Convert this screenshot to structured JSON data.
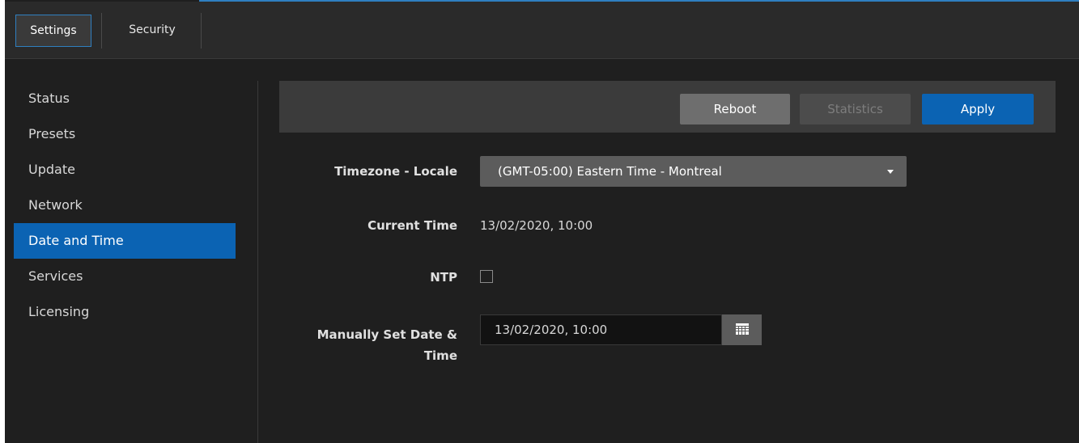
{
  "tabs": [
    {
      "label": "Settings",
      "active": true
    },
    {
      "label": "Security",
      "active": false
    }
  ],
  "sidebar": {
    "items": [
      {
        "label": "Status"
      },
      {
        "label": "Presets"
      },
      {
        "label": "Update"
      },
      {
        "label": "Network"
      },
      {
        "label": "Date and Time",
        "active": true
      },
      {
        "label": "Services"
      },
      {
        "label": "Licensing"
      }
    ]
  },
  "toolbar": {
    "reboot_label": "Reboot",
    "statistics_label": "Statistics",
    "apply_label": "Apply"
  },
  "form": {
    "timezone_label": "Timezone - Locale",
    "timezone_value": "(GMT-05:00) Eastern Time - Montreal",
    "current_time_label": "Current Time",
    "current_time_value": "13/02/2020, 10:00",
    "ntp_label": "NTP",
    "ntp_checked": false,
    "manual_label_line1": "Manually Set Date &",
    "manual_label_line2": "Time",
    "manual_value": "13/02/2020, 10:00"
  },
  "colors": {
    "accent": "#0b63b3",
    "background": "#1f1f1f",
    "topbar": "#2a2a2a"
  },
  "icons": [
    "chevron-down-icon",
    "calendar-icon"
  ]
}
